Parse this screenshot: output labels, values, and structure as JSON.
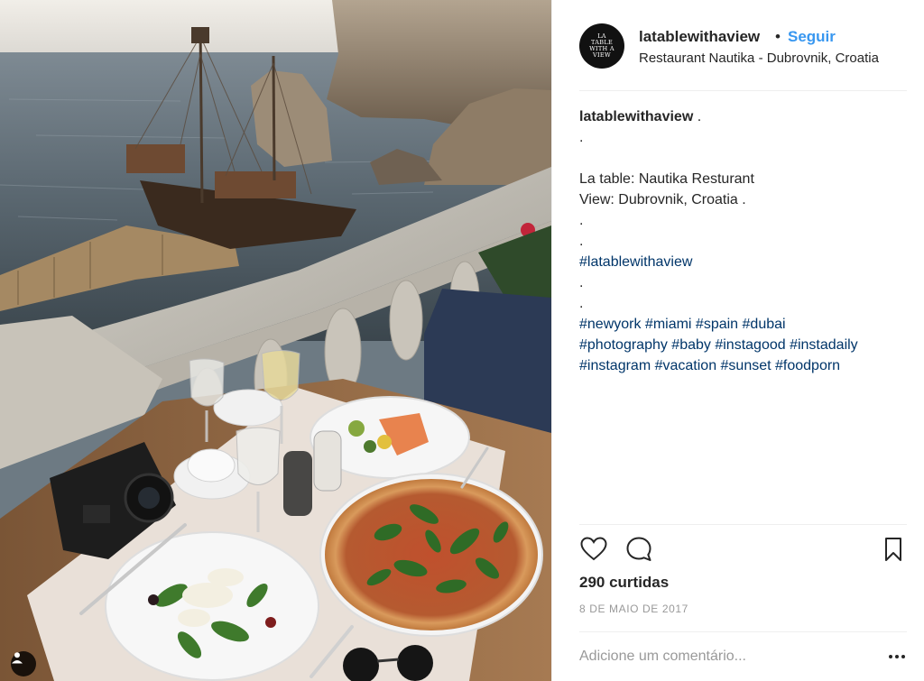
{
  "post": {
    "username": "latablewithaview",
    "separator": "•",
    "follow_label": "Seguir",
    "location": "Restaurant Nautika - Dubrovnik, Croatia",
    "avatar_text": "LA TABLE WITH A VIEW",
    "caption": {
      "author": "latablewithaview",
      "lines": [
        " .",
        ".",
        "",
        "La table: Nautika Resturant",
        "View: Dubrovnik, Croatia .",
        ".",
        ".",
        "#latablewithaview",
        ".",
        ".",
        "#newyork #miami #spain #dubai",
        "#photography #baby #instagood #instadaily",
        "#instagram #vacation #sunset #foodporn"
      ]
    },
    "likes": "290 curtidas",
    "date": "8 DE MAIO DE 2017",
    "comment_placeholder": "Adicione um comentário...",
    "icons": {
      "like": "heart-icon",
      "comment": "comment-icon",
      "save": "bookmark-icon",
      "more": "more-options-icon",
      "user_tag": "user-tag-icon"
    },
    "colors": {
      "follow": "#3897f0",
      "hashtag": "#003569",
      "muted": "#999999"
    }
  }
}
